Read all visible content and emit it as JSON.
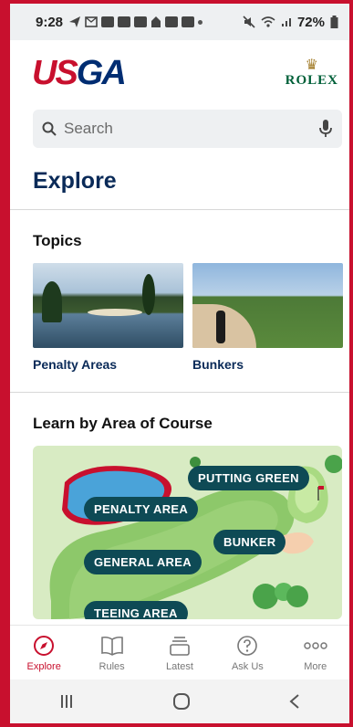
{
  "status_bar": {
    "time": "9:28",
    "battery": "72%"
  },
  "header": {
    "logo_left_1": "US",
    "logo_left_2": "GA",
    "logo_right": "ROLEX"
  },
  "search": {
    "placeholder": "Search"
  },
  "page_title": "Explore",
  "topics": {
    "title": "Topics",
    "items": [
      {
        "label": "Penalty Areas"
      },
      {
        "label": "Bunkers"
      }
    ]
  },
  "learn_area": {
    "title": "Learn by Area of Course",
    "labels": {
      "putting_green": "PUTTING GREEN",
      "penalty_area": "PENALTY AREA",
      "bunker": "BUNKER",
      "general_area": "GENERAL AREA",
      "teeing_area": "TEEING AREA"
    }
  },
  "tabs": [
    {
      "label": "Explore",
      "icon": "compass-icon",
      "active": true
    },
    {
      "label": "Rules",
      "icon": "book-icon",
      "active": false
    },
    {
      "label": "Latest",
      "icon": "stack-icon",
      "active": false
    },
    {
      "label": "Ask Us",
      "icon": "question-icon",
      "active": false
    },
    {
      "label": "More",
      "icon": "more-icon",
      "active": false
    }
  ],
  "colors": {
    "accent_red": "#c8102e",
    "navy": "#0a2a58",
    "pill": "#0e4a55"
  }
}
